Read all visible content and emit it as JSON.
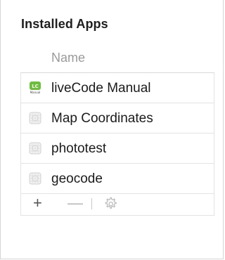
{
  "section": {
    "title": "Installed Apps"
  },
  "table": {
    "column_header": "Name",
    "rows": [
      {
        "label": "liveCode Manual",
        "icon": "livecode-app-icon"
      },
      {
        "label": "Map Coordinates",
        "icon": "generic-app-icon"
      },
      {
        "label": "phototest",
        "icon": "generic-app-icon"
      },
      {
        "label": "geocode",
        "icon": "generic-app-icon"
      }
    ]
  },
  "toolbar": {
    "add_label": "+",
    "remove_label": "—",
    "settings_icon": "gear-icon"
  },
  "colors": {
    "livecode_green": "#6cbf3a",
    "disabled": "#b5b5b5"
  }
}
